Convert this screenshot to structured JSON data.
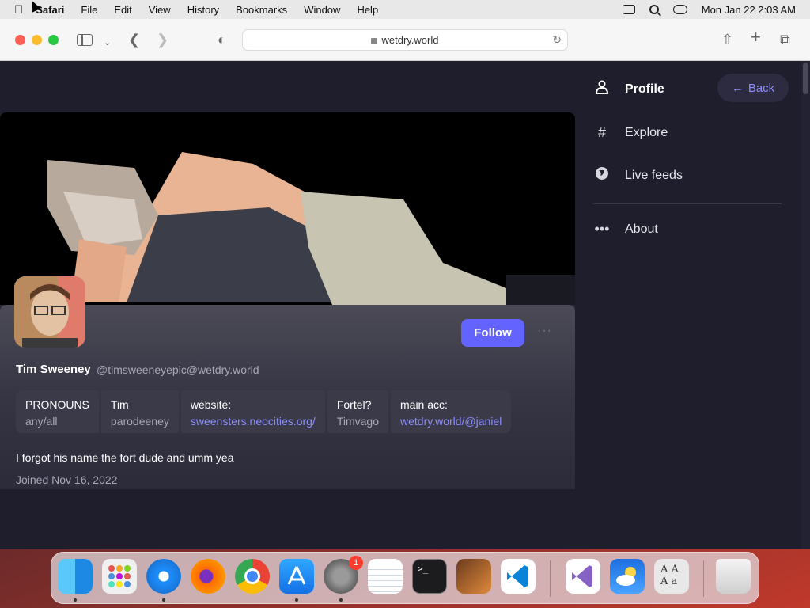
{
  "menubar": {
    "app": "Safari",
    "items": [
      "File",
      "Edit",
      "View",
      "History",
      "Bookmarks",
      "Window",
      "Help"
    ],
    "datetime": "Mon Jan 22  2:03 AM"
  },
  "browser": {
    "url": "wetdry.world"
  },
  "profile": {
    "display_name": "Tim Sweeney",
    "handle": "@timsweeneyepic@wetdry.world",
    "follow_label": "Follow",
    "more_label": "···",
    "fields": [
      {
        "name": "PRONOUNS",
        "value": "any/all",
        "link": false
      },
      {
        "name": "Tim",
        "value": "parodeeney",
        "link": false
      },
      {
        "name": "website:",
        "value": "sweensters.neocities.org/",
        "link": true
      },
      {
        "name": "Fortel?",
        "value": "Timvago",
        "link": false
      },
      {
        "name": "main acc:",
        "value": "wetdry.world/@janiel",
        "link": true
      }
    ],
    "bio": "I forgot his name the fort dude and umm yea",
    "joined": "Joined Nov 16, 2022"
  },
  "nav": {
    "items": [
      {
        "label": "Profile",
        "icon": "person-icon"
      },
      {
        "label": "Explore",
        "icon": "hashtag-icon"
      },
      {
        "label": "Live feeds",
        "icon": "globe-icon"
      },
      {
        "label": "About",
        "icon": "ellipsis-icon"
      }
    ],
    "back_label": "Back"
  },
  "dock": {
    "apps": [
      "Finder",
      "Launchpad",
      "Safari",
      "Firefox",
      "Chrome",
      "App Store",
      "System Settings",
      "TextEdit",
      "Terminal",
      "GarageBand",
      "VS Code",
      "Visual Studio",
      "Weather",
      "Font Book",
      "Trash"
    ],
    "settings_badge": "1"
  },
  "colors": {
    "accent": "#6364ff",
    "link": "#8c8dff",
    "page_bg": "#1f1e2c"
  }
}
